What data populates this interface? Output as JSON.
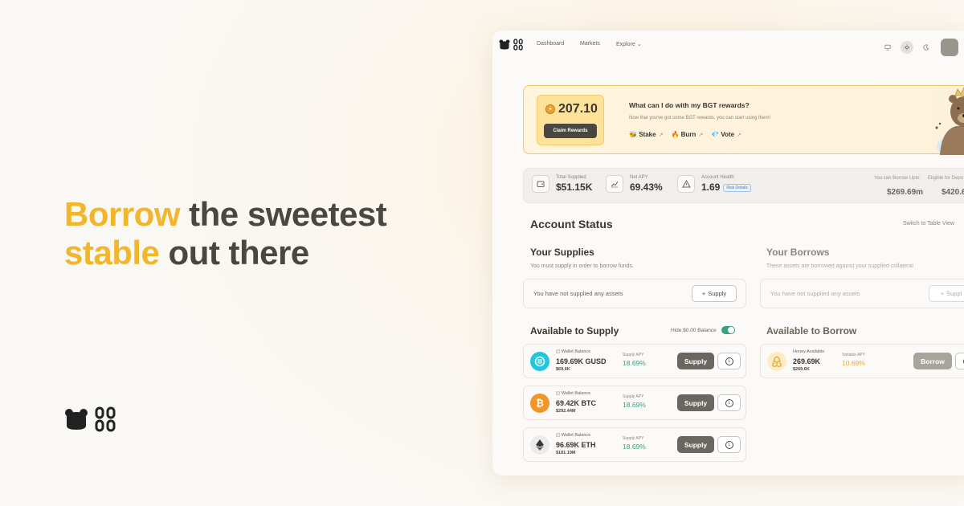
{
  "hero": {
    "line1_accent": "Borrow",
    "line1_rest": " the sweetest",
    "line2_accent": "stable",
    "line2_rest": " out there"
  },
  "colors": {
    "accent": "#f2b62d",
    "green": "#3aa17e",
    "honey": "#e5a93a",
    "dark": "#4a4641"
  },
  "nav": {
    "links": [
      "Dashboard",
      "Markets",
      "Explore"
    ],
    "explore_chevron": "⌄",
    "icons": [
      "monitor-icon",
      "sun-icon",
      "moon-icon"
    ]
  },
  "banner": {
    "reward_amount": "207.10",
    "claim_label": "Claim Rewards",
    "question": "What can I do with my BGT rewards?",
    "subtitle": "Now that you've got some BGT rewards, you can start using them!",
    "actions": [
      {
        "emoji": "🐝",
        "label": "Stake"
      },
      {
        "emoji": "🔥",
        "label": "Burn"
      },
      {
        "emoji": "💎",
        "label": "Vote"
      }
    ]
  },
  "stats": {
    "total_supplied_label": "Total Supplied",
    "total_supplied_value": "$51.15K",
    "net_apy_label": "Net APY",
    "net_apy_value": "69.43%",
    "health_label": "Account Health",
    "health_value": "1.69",
    "risk_label": "Risk Details",
    "borrow_upto_label": "You can Borrow Upto",
    "borrow_upto_value": "$269.69m",
    "eligible_label": "Eligible for Depo",
    "eligible_value": "$420.6"
  },
  "account": {
    "title": "Account Status",
    "switch_view": "Switch to Table View"
  },
  "supplies": {
    "title": "Your Supplies",
    "subtitle": "You must supply in order to borrow funds.",
    "empty": "You have not supplied any assets",
    "button": "Supply"
  },
  "borrows": {
    "title": "Your Borrows",
    "subtitle": "These assets are borrowed against your supplied collateral",
    "empty": "You have not supplied any assets",
    "button": "Suppl"
  },
  "available_supply": {
    "title": "Available to Supply",
    "hide_zero": "Hide $0.00 Balance",
    "hide_zero_on": true,
    "assets": [
      {
        "icon": "gusd-icon",
        "wallet_label": "Wallet Balance",
        "amount": "169.69K GUSD",
        "usd": "$69.6K",
        "apy_label": "Supply APY",
        "apy": "18.69%",
        "button": "Supply"
      },
      {
        "icon": "btc-icon",
        "wallet_label": "Wallet Balance",
        "amount": "69.42K BTC",
        "usd": "$292.44M",
        "apy_label": "Supply APY",
        "apy": "18.69%",
        "button": "Supply"
      },
      {
        "icon": "eth-icon",
        "wallet_label": "Wallet Balance",
        "amount": "96.69K ETH",
        "usd": "$181.19M",
        "apy_label": "Supply APY",
        "apy": "18.69%",
        "button": "Supply"
      }
    ]
  },
  "available_borrow": {
    "title": "Available to Borrow",
    "asset": {
      "icon": "honey-icon",
      "available_label": "Honey Available",
      "amount": "269.69K",
      "usd": "$269.6K",
      "apy_label": "Variable APY",
      "apy": "10.69%",
      "button": "Borrow"
    }
  }
}
